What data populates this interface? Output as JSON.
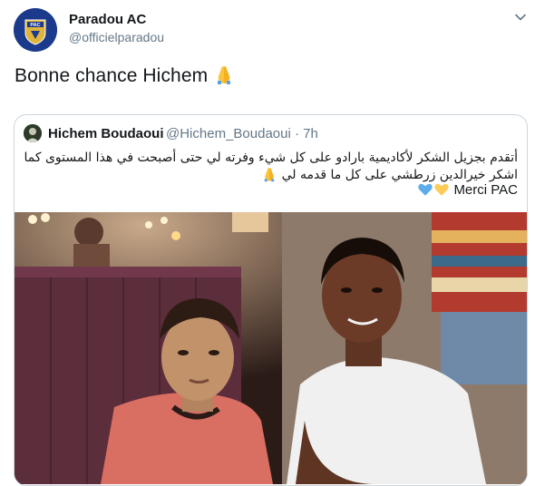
{
  "tweet": {
    "display_name": "Paradou AC",
    "handle": "@officielparadou",
    "avatar_text": "PAC",
    "text": "Bonne chance Hichem",
    "emoji": "folded-hands",
    "menu_icon": "chevron-down-icon"
  },
  "quoted_tweet": {
    "display_name": "Hichem Boudaoui",
    "handle": "@Hichem_Boudaoui",
    "time": "· 7h",
    "text_arabic": "أتقدم بجزيل الشكر لأكاديمية بارادو على كل شيء وفرته لي حتى أصبحت في هذا المستوى كما اشكر خيرالدين زرطشي على كل ما قدمه لي",
    "text_signoff": "Merci PAC",
    "emojis": [
      "folded-hands",
      "blue-heart",
      "yellow-heart"
    ],
    "photo": "two young men posing in a restaurant"
  },
  "colors": {
    "handle_gray": "#657786",
    "border": "#ccd6dd",
    "brand_blue": "#1b3a8c",
    "gold": "#e0b33a"
  }
}
